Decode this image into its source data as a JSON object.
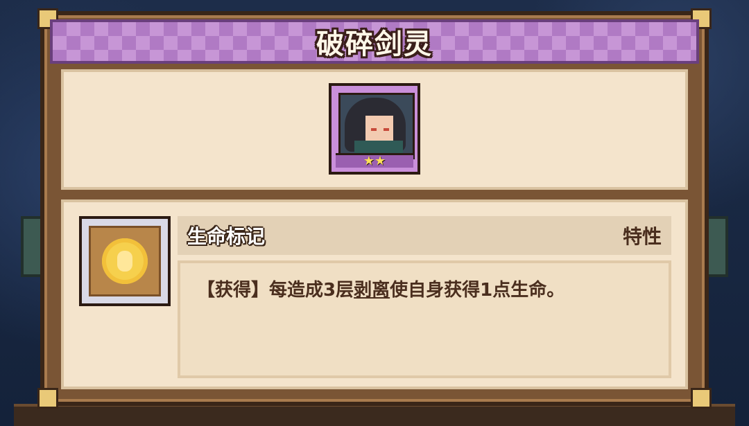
{
  "dialog": {
    "title": "破碎剑灵",
    "stars": 2
  },
  "trait": {
    "name": "生命标记",
    "type_label": "特性",
    "description_prefix": "【获得】每造成3层",
    "description_keyword": "剥离",
    "description_suffix": "使自身获得1点生命。"
  },
  "colors": {
    "title_bar": "#b07ac4",
    "frame": "#7a5535",
    "panel": "#f4e4cc",
    "text": "#4a2e1e",
    "star": "#ffe05a"
  },
  "icons": {
    "portrait": "character-portrait-icon",
    "trait": "life-mark-icon"
  }
}
